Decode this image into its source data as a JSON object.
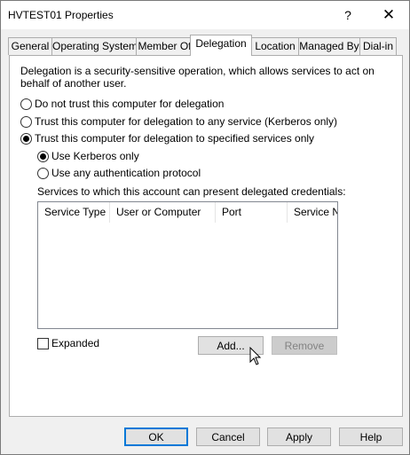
{
  "window": {
    "title": "HVTEST01 Properties",
    "help_glyph": "?",
    "close_glyph": "✕"
  },
  "tabs": [
    {
      "label": "General"
    },
    {
      "label": "Operating System"
    },
    {
      "label": "Member Of"
    },
    {
      "label": "Delegation",
      "active": true
    },
    {
      "label": "Location"
    },
    {
      "label": "Managed By"
    },
    {
      "label": "Dial-in"
    }
  ],
  "delegation": {
    "description_line1": "Delegation is a security-sensitive operation, which allows services to act on",
    "description_line2": "behalf of another user.",
    "options": [
      {
        "label": "Do not trust this computer for delegation",
        "selected": false
      },
      {
        "label": "Trust this computer for delegation to any service (Kerberos only)",
        "selected": false
      },
      {
        "label": "Trust this computer for delegation to specified services only",
        "selected": true
      }
    ],
    "sub_options": [
      {
        "label": "Use Kerberos only",
        "selected": true
      },
      {
        "label": "Use any authentication protocol",
        "selected": false
      }
    ],
    "services_label": "Services to which this account can present delegated credentials:",
    "columns": [
      "Service Type",
      "User or Computer",
      "Port",
      "Service Na"
    ],
    "expanded_label": "Expanded",
    "expanded_checked": false,
    "add_label": "Add...",
    "remove_label": "Remove"
  },
  "footer": {
    "ok": "OK",
    "cancel": "Cancel",
    "apply": "Apply",
    "help": "Help"
  }
}
